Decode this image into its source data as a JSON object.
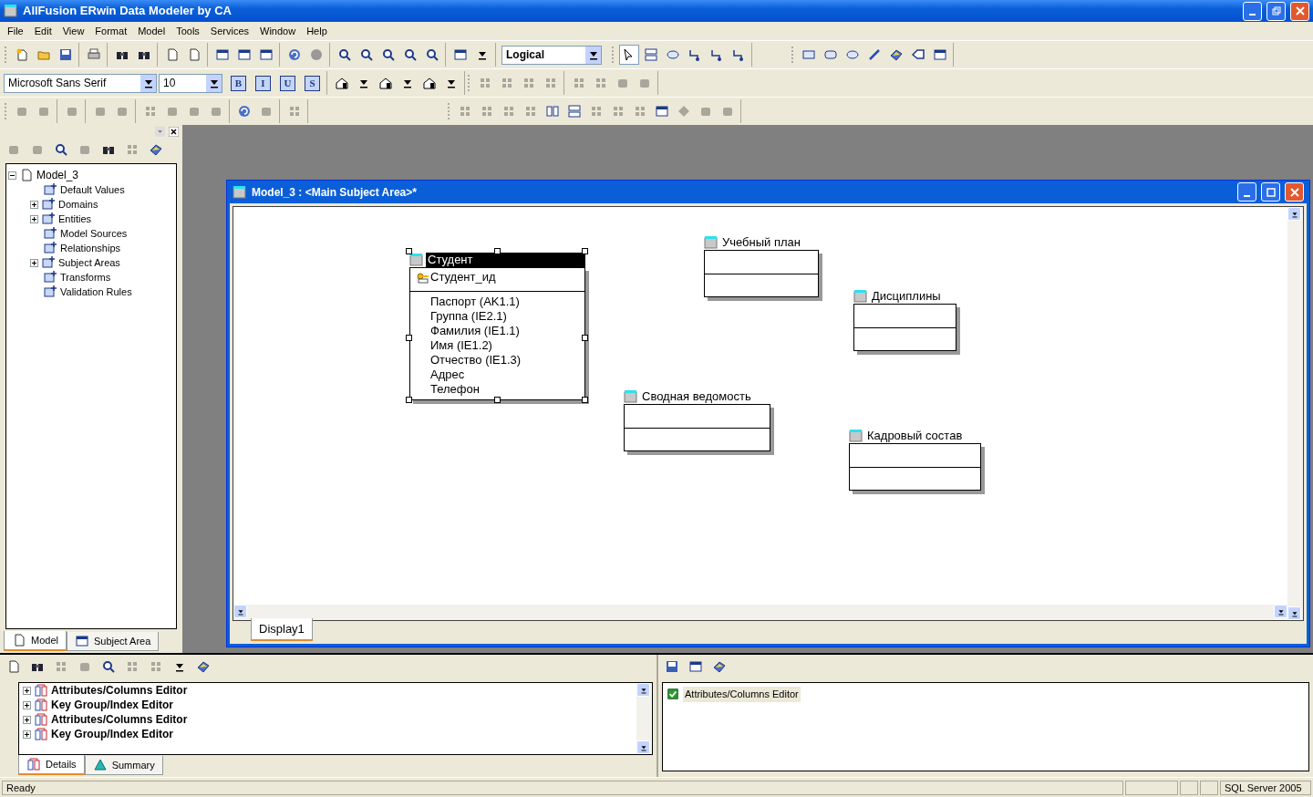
{
  "window": {
    "title": "AllFusion ERwin Data Modeler by CA"
  },
  "menu": [
    {
      "label": "File"
    },
    {
      "label": "Edit"
    },
    {
      "label": "View"
    },
    {
      "label": "Format"
    },
    {
      "label": "Model"
    },
    {
      "label": "Tools"
    },
    {
      "label": "Services"
    },
    {
      "label": "Window"
    },
    {
      "label": "Help"
    }
  ],
  "toolbar": {
    "view_mode": "Logical",
    "font": "Microsoft Sans Serif",
    "font_size": "10",
    "format_buttons": [
      "B",
      "I",
      "U",
      "S"
    ]
  },
  "model_tree": {
    "root": "Model_3",
    "expanded": true,
    "children": [
      {
        "label": "Default Values",
        "kind": "leaf"
      },
      {
        "label": "Domains",
        "kind": "group"
      },
      {
        "label": "Entities",
        "kind": "group"
      },
      {
        "label": "Model Sources",
        "kind": "leaf"
      },
      {
        "label": "Relationships",
        "kind": "leaf"
      },
      {
        "label": "Subject Areas",
        "kind": "group"
      },
      {
        "label": "Transforms",
        "kind": "leaf"
      },
      {
        "label": "Validation Rules",
        "kind": "leaf"
      }
    ]
  },
  "tree_tabs": [
    {
      "label": "Model",
      "selected": true
    },
    {
      "label": "Subject Area",
      "selected": false
    }
  ],
  "diagram_window": {
    "title": "Model_3 : <Main Subject Area>*",
    "entities": [
      {
        "name": "Студент",
        "selected": true,
        "keys": [
          "Студент_ид"
        ],
        "attributes": [
          "Паспорт (AK1.1)",
          "Группа (IE2.1)",
          "Фамилия (IE1.1)",
          "Имя (IE1.2)",
          "Отчество (IE1.3)",
          "Адрес",
          "Телефон"
        ]
      },
      {
        "name": "Учебный план",
        "selected": false
      },
      {
        "name": "Дисциплины",
        "selected": false
      },
      {
        "name": "Сводная ведомость",
        "selected": false
      },
      {
        "name": "Кадровый состав",
        "selected": false
      }
    ],
    "tabs": [
      {
        "label": "Display1",
        "selected": true
      }
    ]
  },
  "details_panel": {
    "items": [
      {
        "label": "Attributes/Columns Editor"
      },
      {
        "label": "Key Group/Index Editor"
      },
      {
        "label": "Attributes/Columns Editor"
      },
      {
        "label": "Key Group/Index Editor"
      }
    ],
    "tabs": [
      {
        "label": "Details",
        "selected": true
      },
      {
        "label": "Summary",
        "selected": false
      }
    ]
  },
  "editors_panel": {
    "items": [
      {
        "label": "Attributes/Columns Editor",
        "checked": true
      }
    ]
  },
  "status_bar": {
    "text": "Ready",
    "target": "SQL Server 2005"
  }
}
